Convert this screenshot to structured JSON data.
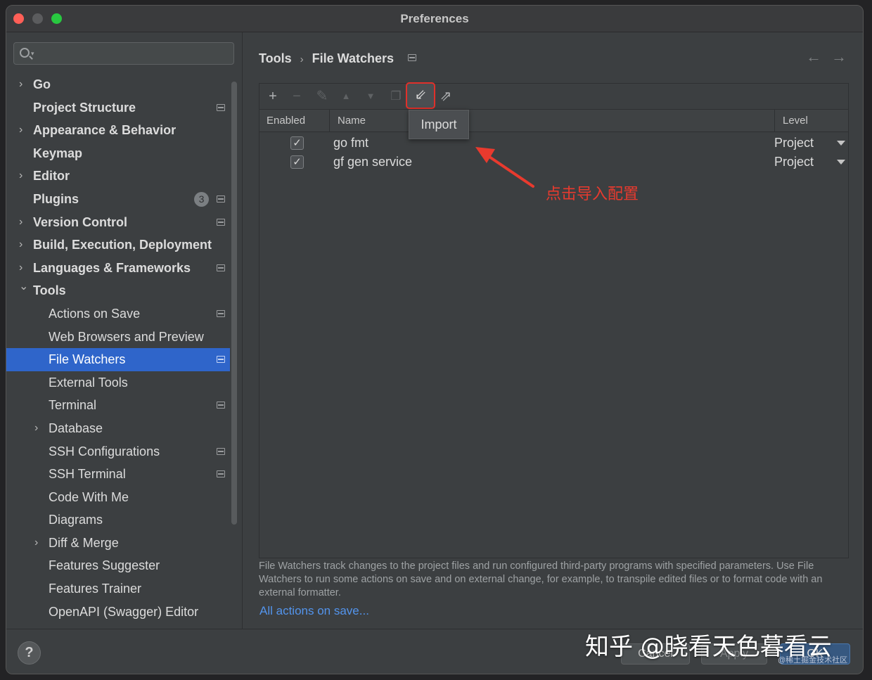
{
  "window": {
    "title": "Preferences"
  },
  "search": {
    "placeholder": ""
  },
  "sidebar": {
    "items": [
      {
        "label": "Go",
        "level": 0,
        "chevron": "right",
        "project_icon": false
      },
      {
        "label": "Project Structure",
        "level": 0,
        "chevron": "",
        "project_icon": true
      },
      {
        "label": "Appearance & Behavior",
        "level": 0,
        "chevron": "right",
        "project_icon": false
      },
      {
        "label": "Keymap",
        "level": 0,
        "chevron": "",
        "project_icon": false
      },
      {
        "label": "Editor",
        "level": 0,
        "chevron": "right",
        "project_icon": false
      },
      {
        "label": "Plugins",
        "level": 0,
        "chevron": "",
        "project_icon": true,
        "badge": "3"
      },
      {
        "label": "Version Control",
        "level": 0,
        "chevron": "right",
        "project_icon": true
      },
      {
        "label": "Build, Execution, Deployment",
        "level": 0,
        "chevron": "right",
        "project_icon": false
      },
      {
        "label": "Languages & Frameworks",
        "level": 0,
        "chevron": "right",
        "project_icon": true
      },
      {
        "label": "Tools",
        "level": 0,
        "chevron": "down",
        "project_icon": false
      },
      {
        "label": "Actions on Save",
        "level": 1,
        "chevron": "",
        "project_icon": true
      },
      {
        "label": "Web Browsers and Preview",
        "level": 1,
        "chevron": "",
        "project_icon": false
      },
      {
        "label": "File Watchers",
        "level": 1,
        "chevron": "",
        "project_icon": true,
        "selected": true
      },
      {
        "label": "External Tools",
        "level": 1,
        "chevron": "",
        "project_icon": false
      },
      {
        "label": "Terminal",
        "level": 1,
        "chevron": "",
        "project_icon": true
      },
      {
        "label": "Database",
        "level": 1,
        "chevron": "right",
        "project_icon": false
      },
      {
        "label": "SSH Configurations",
        "level": 1,
        "chevron": "",
        "project_icon": true
      },
      {
        "label": "SSH Terminal",
        "level": 1,
        "chevron": "",
        "project_icon": true
      },
      {
        "label": "Code With Me",
        "level": 1,
        "chevron": "",
        "project_icon": false
      },
      {
        "label": "Diagrams",
        "level": 1,
        "chevron": "",
        "project_icon": false
      },
      {
        "label": "Diff & Merge",
        "level": 1,
        "chevron": "right",
        "project_icon": false
      },
      {
        "label": "Features Suggester",
        "level": 1,
        "chevron": "",
        "project_icon": false
      },
      {
        "label": "Features Trainer",
        "level": 1,
        "chevron": "",
        "project_icon": false
      },
      {
        "label": "OpenAPI (Swagger) Editor",
        "level": 1,
        "chevron": "",
        "project_icon": false
      }
    ]
  },
  "breadcrumb": {
    "parent": "Tools",
    "current": "File Watchers"
  },
  "toolbar": {
    "add": "+",
    "remove": "−",
    "edit": "✎",
    "up": "▲",
    "down": "▼",
    "copy": "❐",
    "import": "⇙",
    "export": "⇗",
    "import_tooltip": "Import"
  },
  "table": {
    "headers": {
      "enabled": "Enabled",
      "name": "Name",
      "level": "Level"
    },
    "rows": [
      {
        "enabled": true,
        "name": "go fmt",
        "level": "Project"
      },
      {
        "enabled": true,
        "name": "gf gen service",
        "level": "Project"
      }
    ]
  },
  "description": {
    "text": "File Watchers track changes to the project files and run configured third-party programs with specified parameters. Use File Watchers to run some actions on save and on external change, for example, to transpile edited files or to format code with an external formatter.",
    "link": "All actions on save..."
  },
  "footer": {
    "help": "?",
    "cancel": "Cancel",
    "apply": "Apply",
    "ok": "OK"
  },
  "annotation": {
    "text": "点击导入配置",
    "color": "#e83a2e"
  },
  "watermark": {
    "text": "知乎 @晓看天色暮看云",
    "sub": "@稀土掘金技术社区"
  },
  "colors": {
    "selected": "#2f65ca",
    "link": "#5394ec",
    "highlight_border": "#e0302a"
  }
}
